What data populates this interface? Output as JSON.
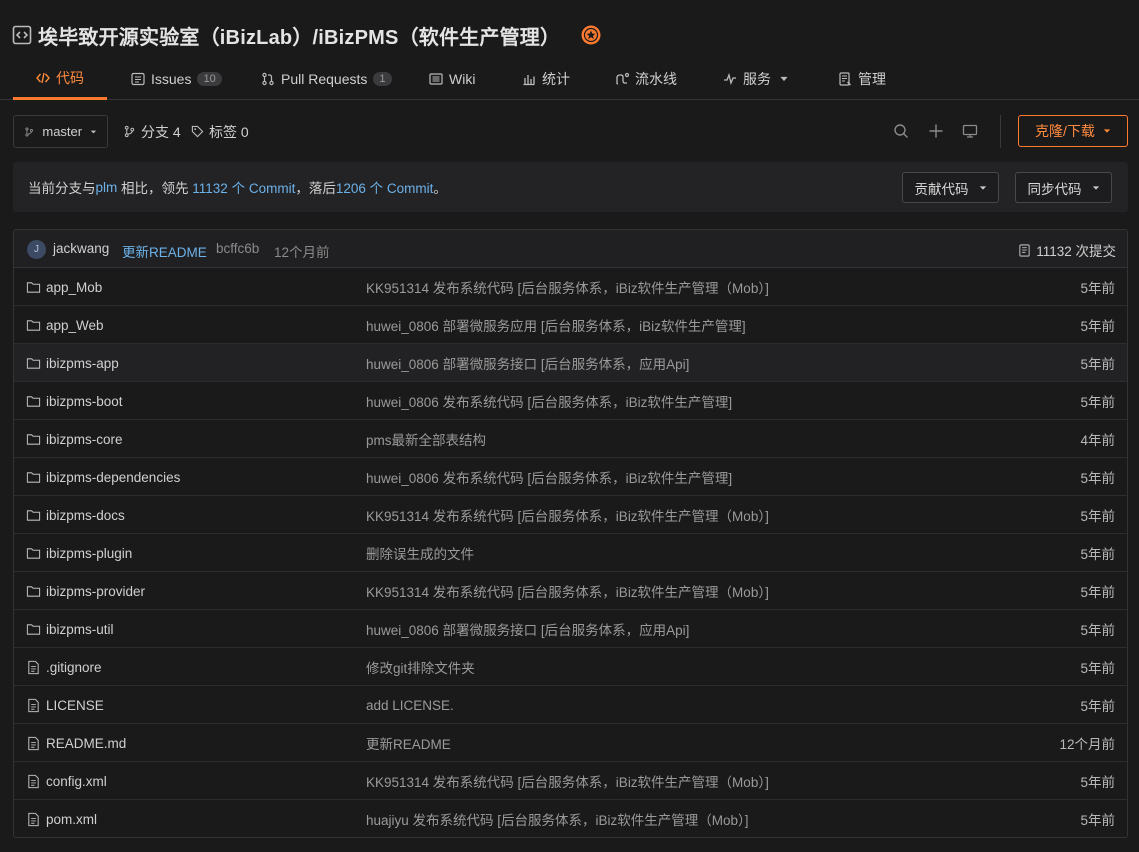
{
  "repo": {
    "title": "埃毕致开源实验室（iBizLab）/iBizPMS（软件生产管理）"
  },
  "tabs": [
    {
      "label": "代码",
      "icon": "code-icon",
      "active": true
    },
    {
      "label": "Issues",
      "icon": "issues-icon",
      "count": "10"
    },
    {
      "label": "Pull Requests",
      "icon": "pull-request-icon",
      "count": "1"
    },
    {
      "label": "Wiki",
      "icon": "wiki-icon"
    },
    {
      "label": "统计",
      "icon": "stats-icon"
    },
    {
      "label": "流水线",
      "icon": "pipeline-icon"
    },
    {
      "label": "服务",
      "icon": "service-icon"
    },
    {
      "label": "管理",
      "icon": "manage-icon"
    }
  ],
  "toolbar": {
    "branch": "master",
    "branches_label": "分支 4",
    "tags_label": "标签 0",
    "clone_label": "克隆/下载"
  },
  "compare": {
    "prefix": "当前分支与 ",
    "branch": "plm",
    "mid1": " 相比，领先 ",
    "ahead": "11132 个 Commit",
    "mid2": "，落后 ",
    "behind": "1206 个 Commit",
    "suffix": "。",
    "contribute_label": "贡献代码",
    "sync_label": "同步代码"
  },
  "last_commit": {
    "avatar_letter": "J",
    "author": "jackwang",
    "message": "更新README",
    "sha": "bcffc6b",
    "time": "12个月前",
    "total": "11132 次提交"
  },
  "files": [
    {
      "name": "app_Mob",
      "type": "folder",
      "commit": "KK951314 发布系统代码 [后台服务体系，iBiz软件生产管理（Mob）]",
      "time": "5年前"
    },
    {
      "name": "app_Web",
      "type": "folder",
      "commit": "huwei_0806 部署微服务应用 [后台服务体系，iBiz软件生产管理]",
      "time": "5年前"
    },
    {
      "name": "ibizpms-app",
      "type": "folder",
      "commit": "huwei_0806 部署微服务接口 [后台服务体系，应用Api]",
      "time": "5年前"
    },
    {
      "name": "ibizpms-boot",
      "type": "folder",
      "commit": "huwei_0806 发布系统代码 [后台服务体系，iBiz软件生产管理]",
      "time": "5年前"
    },
    {
      "name": "ibizpms-core",
      "type": "folder",
      "commit": "pms最新全部表结构",
      "time": "4年前"
    },
    {
      "name": "ibizpms-dependencies",
      "type": "folder",
      "commit": "huwei_0806 发布系统代码 [后台服务体系，iBiz软件生产管理]",
      "time": "5年前"
    },
    {
      "name": "ibizpms-docs",
      "type": "folder",
      "commit": "KK951314 发布系统代码 [后台服务体系，iBiz软件生产管理（Mob）]",
      "time": "5年前"
    },
    {
      "name": "ibizpms-plugin",
      "type": "folder",
      "commit": "删除误生成的文件",
      "time": "5年前"
    },
    {
      "name": "ibizpms-provider",
      "type": "folder",
      "commit": "KK951314 发布系统代码 [后台服务体系，iBiz软件生产管理（Mob）]",
      "time": "5年前"
    },
    {
      "name": "ibizpms-util",
      "type": "folder",
      "commit": "huwei_0806 部署微服务接口 [后台服务体系，应用Api]",
      "time": "5年前"
    },
    {
      "name": ".gitignore",
      "type": "file",
      "commit": "修改git排除文件夹",
      "time": "5年前"
    },
    {
      "name": "LICENSE",
      "type": "file",
      "commit": "add LICENSE.",
      "time": "5年前"
    },
    {
      "name": "README.md",
      "type": "file",
      "commit": "更新README",
      "time": "12个月前"
    },
    {
      "name": "config.xml",
      "type": "file",
      "commit": "KK951314 发布系统代码 [后台服务体系，iBiz软件生产管理（Mob）]",
      "time": "5年前"
    },
    {
      "name": "pom.xml",
      "type": "file",
      "commit": "huajiyu 发布系统代码 [后台服务体系，iBiz软件生产管理（Mob）]",
      "time": "5年前"
    }
  ],
  "colors": {
    "accent": "#ff7a2f",
    "link": "#6cb1e8",
    "background": "#1a1a1b"
  }
}
